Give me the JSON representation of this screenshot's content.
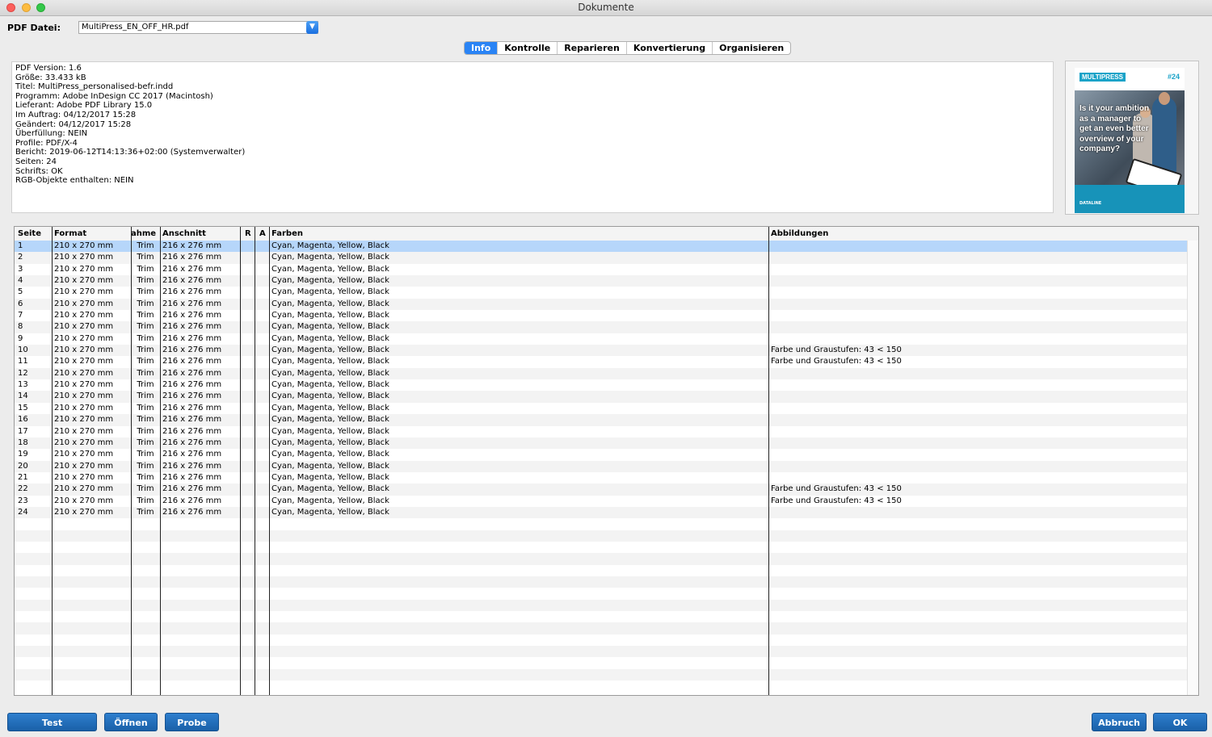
{
  "window": {
    "title": "Dokumente"
  },
  "pdf_file": {
    "label": "PDF Datei:",
    "value": "MultiPress_EN_OFF_HR.pdf"
  },
  "tabs": [
    {
      "label": "Info",
      "active": true
    },
    {
      "label": "Kontrolle"
    },
    {
      "label": "Reparieren"
    },
    {
      "label": "Konvertierung"
    },
    {
      "label": "Organisieren"
    }
  ],
  "info": {
    "lines": [
      "PDF Version: 1.6",
      "Größe: 33.433 kB",
      "Titel: MultiPress_personalised-befr.indd",
      "Programm: Adobe InDesign CC 2017 (Macintosh)",
      "Lieferant: Adobe PDF Library 15.0",
      "Im Auftrag: 04/12/2017 15:28",
      "Geändert: 04/12/2017 15:28",
      "Überfüllung: NEIN",
      "Profile: PDF/X-4",
      "Bericht: 2019-06-12T14:13:36+02:00 (Systemverwalter)",
      "Seiten: 24",
      "Schrifts: OK",
      "RGB-Objekte enthalten: NEIN"
    ]
  },
  "thumbnail": {
    "brand": "MULTIPRESS",
    "issue": "#24",
    "headline": "Is it your ambition as a manager to get an even better overview of your company?",
    "footer_brand": "DATALINE"
  },
  "table": {
    "headers": [
      "Seite",
      "Format",
      "ahme",
      "Anschnitt",
      "R",
      "A",
      "Farben",
      "Abbildungen"
    ],
    "rows": [
      [
        "1",
        "210 x 270 mm",
        "Trim",
        "216 x 276 mm",
        "",
        "",
        "Cyan, Magenta, Yellow, Black",
        ""
      ],
      [
        "2",
        "210 x 270 mm",
        "Trim",
        "216 x 276 mm",
        "",
        "",
        "Cyan, Magenta, Yellow, Black",
        ""
      ],
      [
        "3",
        "210 x 270 mm",
        "Trim",
        "216 x 276 mm",
        "",
        "",
        "Cyan, Magenta, Yellow, Black",
        ""
      ],
      [
        "4",
        "210 x 270 mm",
        "Trim",
        "216 x 276 mm",
        "",
        "",
        "Cyan, Magenta, Yellow, Black",
        ""
      ],
      [
        "5",
        "210 x 270 mm",
        "Trim",
        "216 x 276 mm",
        "",
        "",
        "Cyan, Magenta, Yellow, Black",
        ""
      ],
      [
        "6",
        "210 x 270 mm",
        "Trim",
        "216 x 276 mm",
        "",
        "",
        "Cyan, Magenta, Yellow, Black",
        ""
      ],
      [
        "7",
        "210 x 270 mm",
        "Trim",
        "216 x 276 mm",
        "",
        "",
        "Cyan, Magenta, Yellow, Black",
        ""
      ],
      [
        "8",
        "210 x 270 mm",
        "Trim",
        "216 x 276 mm",
        "",
        "",
        "Cyan, Magenta, Yellow, Black",
        ""
      ],
      [
        "9",
        "210 x 270 mm",
        "Trim",
        "216 x 276 mm",
        "",
        "",
        "Cyan, Magenta, Yellow, Black",
        ""
      ],
      [
        "10",
        "210 x 270 mm",
        "Trim",
        "216 x 276 mm",
        "",
        "",
        "Cyan, Magenta, Yellow, Black",
        "Farbe und Graustufen: 43 < 150"
      ],
      [
        "11",
        "210 x 270 mm",
        "Trim",
        "216 x 276 mm",
        "",
        "",
        "Cyan, Magenta, Yellow, Black",
        "Farbe und Graustufen: 43 < 150"
      ],
      [
        "12",
        "210 x 270 mm",
        "Trim",
        "216 x 276 mm",
        "",
        "",
        "Cyan, Magenta, Yellow, Black",
        ""
      ],
      [
        "13",
        "210 x 270 mm",
        "Trim",
        "216 x 276 mm",
        "",
        "",
        "Cyan, Magenta, Yellow, Black",
        ""
      ],
      [
        "14",
        "210 x 270 mm",
        "Trim",
        "216 x 276 mm",
        "",
        "",
        "Cyan, Magenta, Yellow, Black",
        ""
      ],
      [
        "15",
        "210 x 270 mm",
        "Trim",
        "216 x 276 mm",
        "",
        "",
        "Cyan, Magenta, Yellow, Black",
        ""
      ],
      [
        "16",
        "210 x 270 mm",
        "Trim",
        "216 x 276 mm",
        "",
        "",
        "Cyan, Magenta, Yellow, Black",
        ""
      ],
      [
        "17",
        "210 x 270 mm",
        "Trim",
        "216 x 276 mm",
        "",
        "",
        "Cyan, Magenta, Yellow, Black",
        ""
      ],
      [
        "18",
        "210 x 270 mm",
        "Trim",
        "216 x 276 mm",
        "",
        "",
        "Cyan, Magenta, Yellow, Black",
        ""
      ],
      [
        "19",
        "210 x 270 mm",
        "Trim",
        "216 x 276 mm",
        "",
        "",
        "Cyan, Magenta, Yellow, Black",
        ""
      ],
      [
        "20",
        "210 x 270 mm",
        "Trim",
        "216 x 276 mm",
        "",
        "",
        "Cyan, Magenta, Yellow, Black",
        ""
      ],
      [
        "21",
        "210 x 270 mm",
        "Trim",
        "216 x 276 mm",
        "",
        "",
        "Cyan, Magenta, Yellow, Black",
        ""
      ],
      [
        "22",
        "210 x 270 mm",
        "Trim",
        "216 x 276 mm",
        "",
        "",
        "Cyan, Magenta, Yellow, Black",
        "Farbe und Graustufen: 43 < 150"
      ],
      [
        "23",
        "210 x 270 mm",
        "Trim",
        "216 x 276 mm",
        "",
        "",
        "Cyan, Magenta, Yellow, Black",
        "Farbe und Graustufen: 43 < 150"
      ],
      [
        "24",
        "210 x 270 mm",
        "Trim",
        "216 x 276 mm",
        "",
        "",
        "Cyan, Magenta, Yellow, Black",
        ""
      ]
    ],
    "selected_row": 0
  },
  "buttons": {
    "test": "Test",
    "open": "Öffnen",
    "probe": "Probe",
    "cancel": "Abbruch",
    "ok": "OK"
  },
  "colors": {
    "accent": "#2a84f5",
    "selection": "#b6d6fa",
    "button": "#1a60a8"
  }
}
